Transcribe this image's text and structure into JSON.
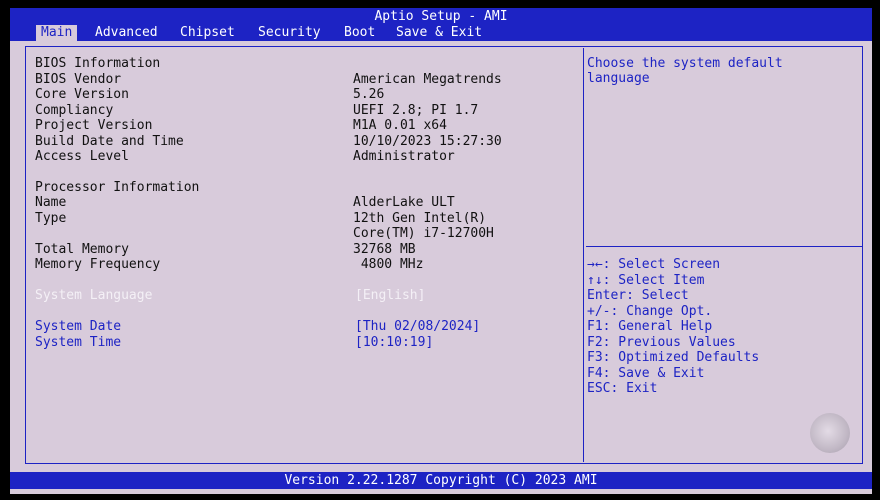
{
  "title": "Aptio Setup - AMI",
  "tabs": [
    {
      "label": "Main",
      "active": true
    },
    {
      "label": "Advanced"
    },
    {
      "label": "Chipset"
    },
    {
      "label": "Security"
    },
    {
      "label": "Boot"
    },
    {
      "label": "Save & Exit"
    }
  ],
  "bios": {
    "header": "BIOS Information",
    "rows": [
      {
        "label": "BIOS Vendor",
        "value": "American Megatrends"
      },
      {
        "label": "Core Version",
        "value": "5.26"
      },
      {
        "label": "Compliancy",
        "value": "UEFI 2.8; PI 1.7"
      },
      {
        "label": "Project Version",
        "value": "M1A 0.01 x64"
      },
      {
        "label": "Build Date and Time",
        "value": "10/10/2023 15:27:30"
      },
      {
        "label": "Access Level",
        "value": "Administrator"
      }
    ]
  },
  "processor": {
    "header": "Processor Information",
    "name_label": "Name",
    "name_value": "AlderLake ULT",
    "type_label": "Type",
    "type_value_1": "12th Gen Intel(R)",
    "type_value_2": "Core(TM) i7-12700H"
  },
  "memory": {
    "total_label": "Total Memory",
    "total_value": "32768 MB",
    "freq_label": "Memory Frequency",
    "freq_value": " 4800 MHz"
  },
  "settings": {
    "language_label": "System Language",
    "language_value": "[English]",
    "date_label": "System Date",
    "date_value": "[Thu 02/08/2024]",
    "time_label": "System Time",
    "time_value": "[10:10:19]"
  },
  "help_text": {
    "line1": "Choose the system default",
    "line2": "language"
  },
  "key_help": [
    "→←: Select Screen",
    "↑↓: Select Item",
    "Enter: Select",
    "+/-: Change Opt.",
    "F1: General Help",
    "F2: Previous Values",
    "F3: Optimized Defaults",
    "F4: Save & Exit",
    "ESC: Exit"
  ],
  "footer": "Version 2.22.1287 Copyright (C) 2023 AMI",
  "colors": {
    "bios_blue": "#1d23c4",
    "panel_bg": "#d8cbdb",
    "highlight": "#f4f0f6"
  }
}
